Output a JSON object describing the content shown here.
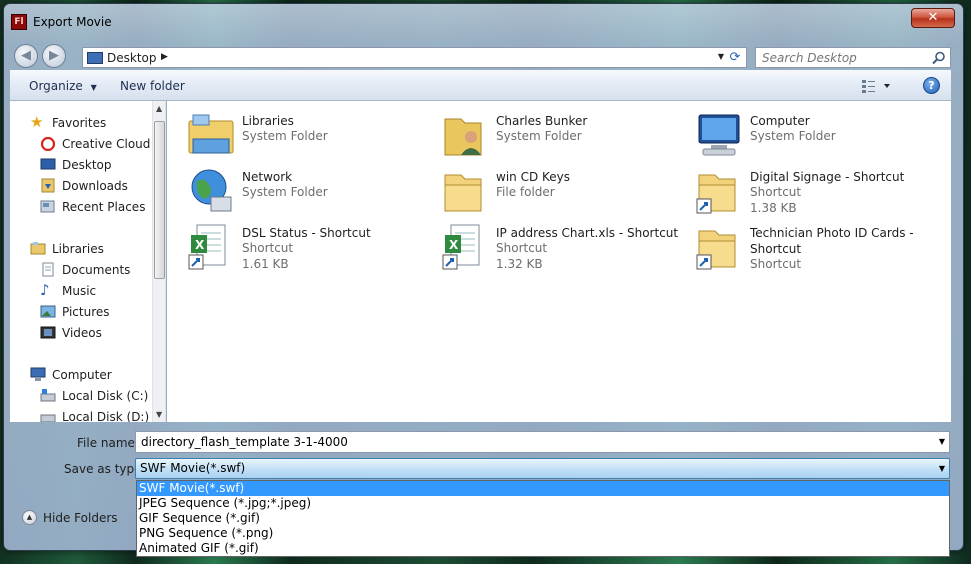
{
  "window": {
    "title": "Export Movie",
    "app_icon_text": "Fl"
  },
  "address": {
    "location": "Desktop",
    "search_placeholder": "Search Desktop"
  },
  "toolbar": {
    "organize_label": "Organize",
    "new_folder_label": "New folder"
  },
  "navigation": {
    "favorites_header": "Favorites",
    "favorites": [
      "Creative Cloud Fi",
      "Desktop",
      "Downloads",
      "Recent Places"
    ],
    "libraries_header": "Libraries",
    "libraries": [
      "Documents",
      "Music",
      "Pictures",
      "Videos"
    ],
    "computer_header": "Computer",
    "computer": [
      "Local Disk (C:)",
      "Local Disk (D:)"
    ]
  },
  "files": [
    {
      "name": "Libraries",
      "type": "System Folder",
      "size": ""
    },
    {
      "name": "Charles Bunker",
      "type": "System Folder",
      "size": ""
    },
    {
      "name": "Computer",
      "type": "System Folder",
      "size": ""
    },
    {
      "name": "Network",
      "type": "System Folder",
      "size": ""
    },
    {
      "name": "win CD Keys",
      "type": "File folder",
      "size": ""
    },
    {
      "name": "Digital Signage - Shortcut",
      "type": "Shortcut",
      "size": "1.38 KB"
    },
    {
      "name": "DSL Status - Shortcut",
      "type": "Shortcut",
      "size": "1.61 KB"
    },
    {
      "name": "IP address Chart.xls - Shortcut",
      "type": "Shortcut",
      "size": "1.32 KB"
    },
    {
      "name": "Technician Photo ID Cards - Shortcut",
      "type": "Shortcut",
      "size": ""
    }
  ],
  "form": {
    "file_name_label": "File name:",
    "file_name_value": "directory_flash_template 3-1-4000",
    "save_type_label": "Save as type:",
    "save_type_value": "SWF Movie(*.swf)"
  },
  "save_type_options": [
    "SWF Movie(*.swf)",
    "JPEG Sequence (*.jpg;*.jpeg)",
    "GIF Sequence (*.gif)",
    "PNG Sequence (*.png)",
    "Animated GIF (*.gif)"
  ],
  "hide_folders_label": "Hide Folders",
  "colors": {
    "selection": "#3399ff",
    "close_button": "#c7472d"
  }
}
